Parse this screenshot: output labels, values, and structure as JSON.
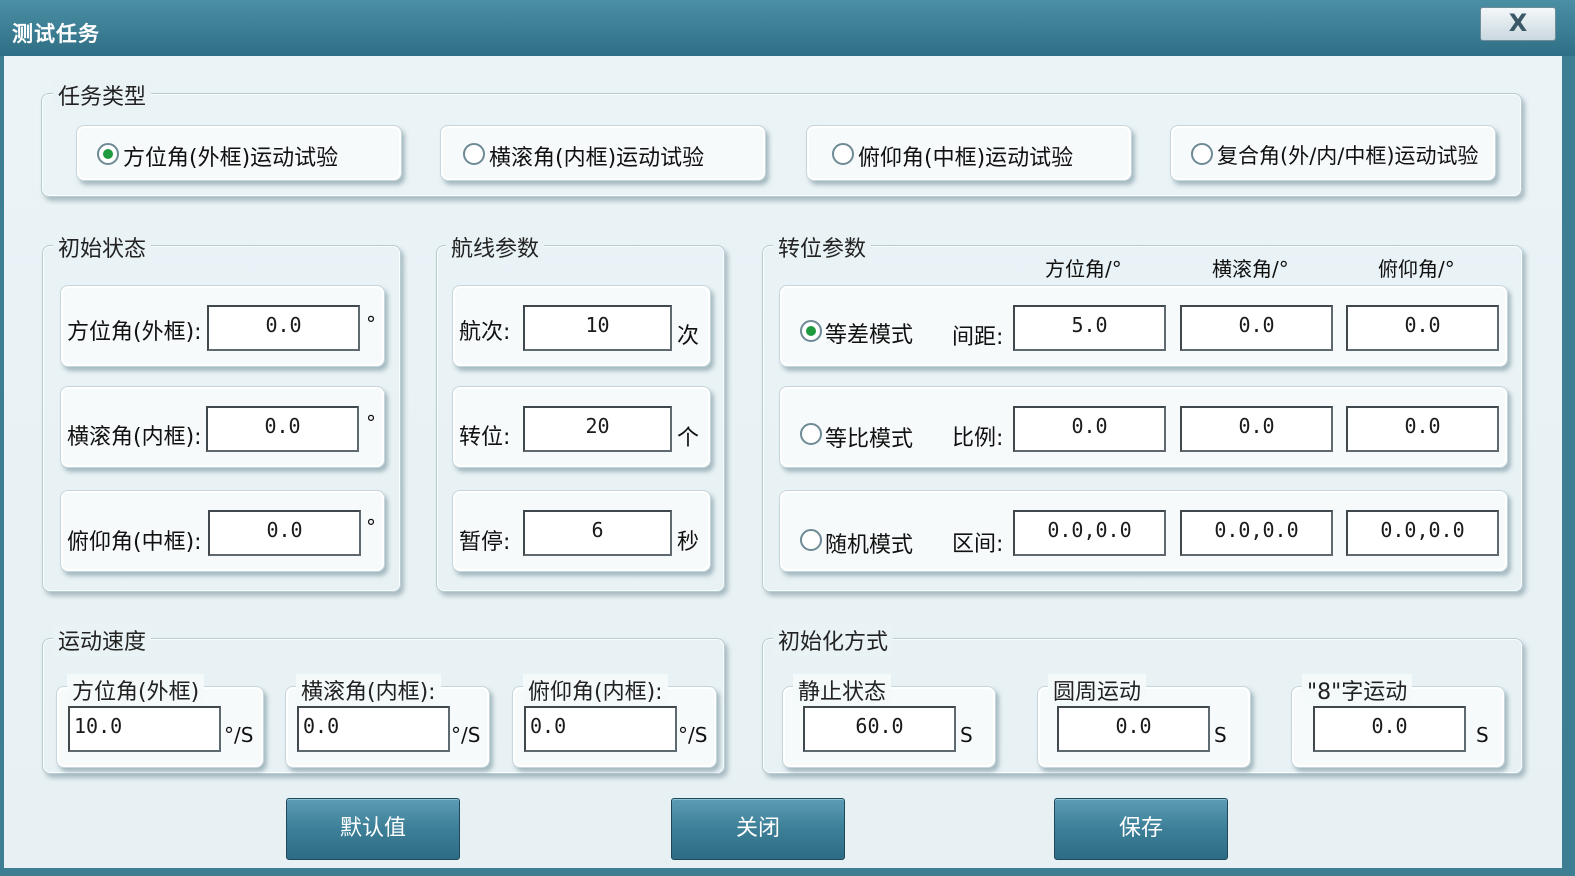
{
  "window": {
    "title": "测试任务",
    "close_label": "X"
  },
  "task_type": {
    "label": "任务类型",
    "options": [
      {
        "label": "方位角(外框)运动试验",
        "selected": true
      },
      {
        "label": "横滚角(内框)运动试验",
        "selected": false
      },
      {
        "label": "俯仰角(中框)运动试验",
        "selected": false
      },
      {
        "label": "复合角(外/内/中框)运动试验",
        "selected": false
      }
    ]
  },
  "initial_state": {
    "label": "初始状态",
    "rows": [
      {
        "label": "方位角(外框):",
        "value": "0.0",
        "unit": "°"
      },
      {
        "label": "横滚角(内框):",
        "value": "0.0",
        "unit": "°"
      },
      {
        "label": "俯仰角(中框):",
        "value": "0.0",
        "unit": "°"
      }
    ]
  },
  "route_params": {
    "label": "航线参数",
    "rows": [
      {
        "label": "航次:",
        "value": "10",
        "unit": "次"
      },
      {
        "label": "转位:",
        "value": "20",
        "unit": "个"
      },
      {
        "label": "暂停:",
        "value": "6",
        "unit": "秒"
      }
    ]
  },
  "index_params": {
    "label": "转位参数",
    "headers": [
      "方位角/°",
      "横滚角/°",
      "俯仰角/°"
    ],
    "modes": [
      {
        "mode": "等差模式",
        "selected": true,
        "field": "间距:",
        "values": [
          "5.0",
          "0.0",
          "0.0"
        ]
      },
      {
        "mode": "等比模式",
        "selected": false,
        "field": "比例:",
        "values": [
          "0.0",
          "0.0",
          "0.0"
        ]
      },
      {
        "mode": "随机模式",
        "selected": false,
        "field": "区间:",
        "values": [
          "0.0,0.0",
          "0.0,0.0",
          "0.0,0.0"
        ]
      }
    ]
  },
  "speed": {
    "label": "运动速度",
    "items": [
      {
        "label": "方位角(外框)",
        "value": "10.0",
        "unit": "°/S"
      },
      {
        "label": "横滚角(内框):",
        "value": "0.0",
        "unit": "°/S"
      },
      {
        "label": "俯仰角(内框):",
        "value": "0.0",
        "unit": "°/S"
      }
    ]
  },
  "init_method": {
    "label": "初始化方式",
    "items": [
      {
        "label": "静止状态",
        "value": "60.0",
        "unit": "S"
      },
      {
        "label": "圆周运动",
        "value": "0.0",
        "unit": "S"
      },
      {
        "label": "\"8\"字运动",
        "value": "0.0",
        "unit": "S"
      }
    ]
  },
  "buttons": {
    "default": "默认值",
    "close": "关闭",
    "save": "保存"
  }
}
